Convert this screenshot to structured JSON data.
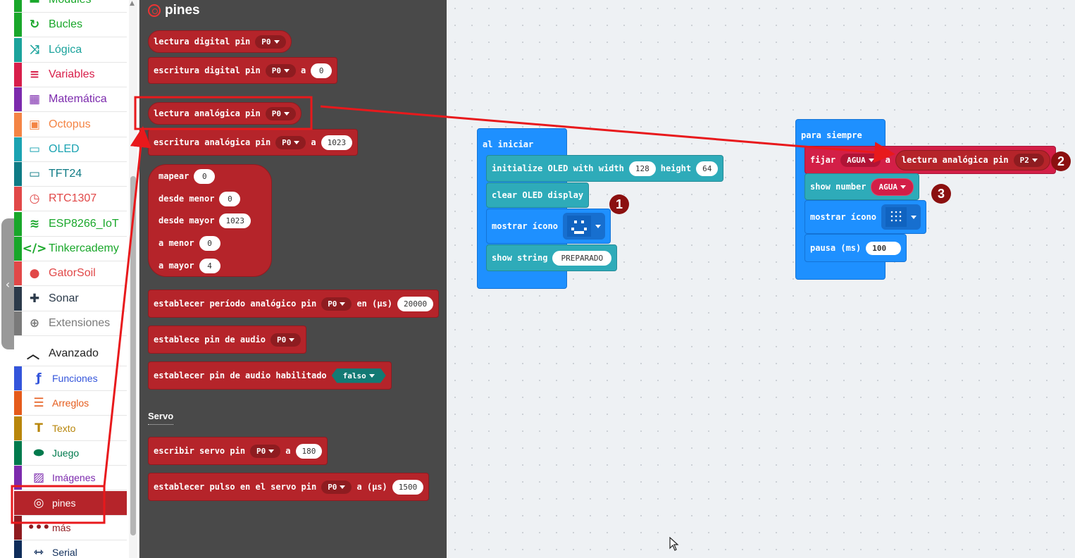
{
  "sidebar": {
    "items": [
      {
        "label": "Modules",
        "color": "#19a72a",
        "icon": "modules-icon",
        "glyph": "▬"
      },
      {
        "label": "Bucles",
        "color": "#19a72a",
        "icon": "loop-icon",
        "glyph": "↻"
      },
      {
        "label": "Lógica",
        "color": "#1ba39c",
        "icon": "shuffle-icon",
        "glyph": "⤨"
      },
      {
        "label": "Variables",
        "color": "#d81e4a",
        "icon": "variables-icon",
        "glyph": "≡"
      },
      {
        "label": "Matemática",
        "color": "#7c2aad",
        "icon": "calculator-icon",
        "glyph": "▦"
      },
      {
        "label": "Octopus",
        "color": "#f48444",
        "icon": "chip-icon",
        "glyph": "▣"
      },
      {
        "label": "OLED",
        "color": "#1ba3b2",
        "icon": "monitor-icon",
        "glyph": "▭"
      },
      {
        "label": "TFT24",
        "color": "#0f7b85",
        "icon": "monitor-icon",
        "glyph": "▭"
      },
      {
        "label": "RTC1307",
        "color": "#e14848",
        "icon": "clock-icon",
        "glyph": "◷"
      },
      {
        "label": "ESP8266_IoT",
        "color": "#19a72a",
        "icon": "wifi-icon",
        "glyph": "≋"
      },
      {
        "label": "Tinkercademy",
        "color": "#19a72a",
        "icon": "code-icon",
        "glyph": "</>"
      },
      {
        "label": "GatorSoil",
        "color": "#e14848",
        "icon": "drop-icon",
        "glyph": "●"
      },
      {
        "label": "Sonar",
        "color": "#2b3a4a",
        "icon": "puzzle-icon",
        "glyph": "✚"
      },
      {
        "label": "Extensiones",
        "color": "#7a7a7a",
        "icon": "plus-circle-icon",
        "glyph": "⊕"
      }
    ],
    "advanced_label": "Avanzado",
    "advanced_items": [
      {
        "label": "Funciones",
        "color": "#3455db",
        "icon": "function-icon",
        "glyph": "ƒ"
      },
      {
        "label": "Arreglos",
        "color": "#e55b1b",
        "icon": "list-icon",
        "glyph": "☰"
      },
      {
        "label": "Texto",
        "color": "#b8860b",
        "icon": "text-icon",
        "glyph": "T"
      },
      {
        "label": "Juego",
        "color": "#007a4d",
        "icon": "gamepad-icon",
        "glyph": "⬬"
      },
      {
        "label": "Imágenes",
        "color": "#7c2aad",
        "icon": "image-icon",
        "glyph": "▨"
      },
      {
        "label": "pines",
        "color": "#b5242a",
        "icon": "pins-icon",
        "glyph": "◎"
      },
      {
        "label": "más",
        "color": "#8f1b20",
        "icon": "more-icon",
        "glyph": "•••"
      },
      {
        "label": "Serial",
        "color": "#0f2d5a",
        "icon": "usb-icon",
        "glyph": "⇿"
      }
    ]
  },
  "flyout": {
    "title": "pines",
    "blocks": {
      "b1": {
        "text": "lectura digital pin",
        "dd": "P0"
      },
      "b2": {
        "text": "escritura digital pin",
        "dd": "P0",
        "a": "a",
        "val": "0"
      },
      "b3": {
        "text": "lectura analógica pin",
        "dd": "P0"
      },
      "b4": {
        "text": "escritura analógica pin",
        "dd": "P0",
        "a": "a",
        "val": "1023"
      },
      "map": {
        "label": "mapear",
        "val": "0",
        "r1": "desde menor",
        "v1": "0",
        "r2": "desde mayor",
        "v2": "1023",
        "r3": "a menor",
        "v3": "0",
        "r4": "a mayor",
        "v4": "4"
      },
      "b5": {
        "text": "establecer período analógico pin",
        "dd": "P0",
        "en": "en (µs)",
        "val": "20000"
      },
      "b6": {
        "text": "establece pin de audio",
        "dd": "P0"
      },
      "b7": {
        "text": "establecer pin de audio habilitado",
        "dd": "falso"
      },
      "servo_label": "Servo",
      "b8": {
        "text": "escribir servo pin",
        "dd": "P0",
        "a": "a",
        "val": "180"
      },
      "b9": {
        "text": "establecer pulso en el servo pin",
        "dd": "P0",
        "a": "a (µs)",
        "val": "1500"
      }
    }
  },
  "workspace": {
    "on_start": {
      "hat": "al iniciar",
      "oled_text": "initialize OLED with width",
      "oled_w": "128",
      "oled_h_label": "height",
      "oled_h": "64",
      "clear": "clear OLED display",
      "show_icon": "mostrar ícono",
      "show_string": "show string",
      "string_val": "PREPARADO"
    },
    "forever": {
      "hat": "para siempre",
      "set": "fijar",
      "var": "AGUA",
      "a": "a",
      "read": "lectura analógica pin",
      "pin": "P2",
      "show_number": "show number",
      "num_var": "AGUA",
      "show_icon": "mostrar ícono",
      "pause": "pausa (ms)",
      "pause_val": "100"
    },
    "markers": [
      "1",
      "2",
      "3"
    ]
  },
  "colors": {
    "pins": "#b5242a",
    "logic": "#1e90ff",
    "oled": "#2eabb9",
    "variables": "#d31f47",
    "annotation": "#e8191c"
  }
}
